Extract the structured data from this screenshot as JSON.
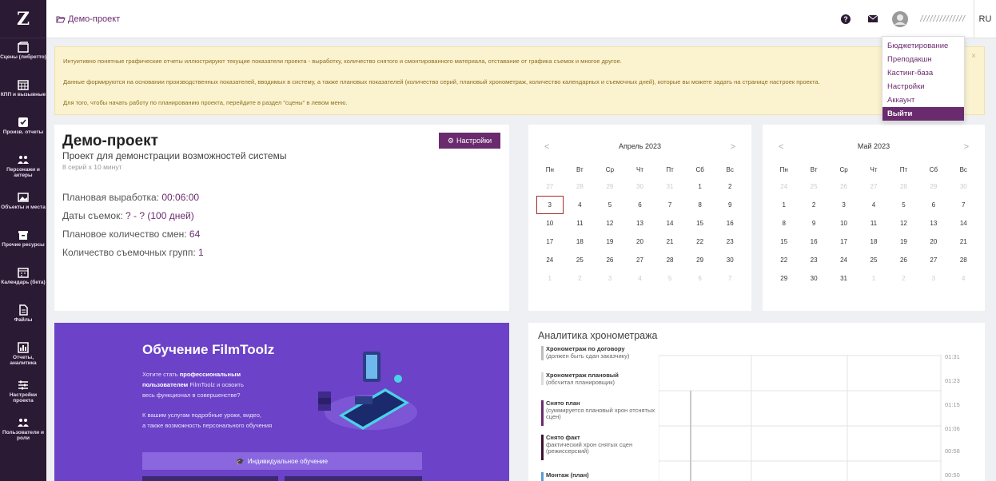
{
  "sidebar": {
    "logo": "Z",
    "items": [
      {
        "label": "Сцены (либретто)",
        "icon": "scenes-icon"
      },
      {
        "label": "КПП и вызывные",
        "icon": "calendar-grid-icon"
      },
      {
        "label": "Произв. отчеты",
        "icon": "checkbox-icon"
      },
      {
        "label": "Персонажи и актеры",
        "icon": "people-icon"
      },
      {
        "label": "Объекты и места",
        "icon": "image-icon"
      },
      {
        "label": "Прочие ресурсы",
        "icon": "box-icon"
      },
      {
        "label": "Календарь (бета)",
        "icon": "calendar-icon"
      },
      {
        "label": "Файлы",
        "icon": "file-icon"
      },
      {
        "label": "Отчеты, аналитика",
        "icon": "bar-chart-icon"
      },
      {
        "label": "Настройки проекта",
        "icon": "sliders-icon"
      },
      {
        "label": "Пользователи и роли",
        "icon": "users-icon"
      }
    ]
  },
  "topbar": {
    "breadcrumb": "Демо-проект",
    "user_name": "//////////////",
    "lang": "RU"
  },
  "user_menu": {
    "items": [
      "Бюджетирование",
      "Преподакшн",
      "Кастинг-база",
      "Настройки",
      "Аккаунт",
      "Выйти"
    ],
    "active_index": 5
  },
  "alert": {
    "line1": "Интуитивно понятные графические отчеты иллюстрируют текущие показатели проекта - выработку, количество снятого и смонтированного материала, отставание от графика съемок и многое другое.",
    "line2": "Данные формируются на основании производственных показателей, вводимых в систему, а также плановых показателей (количество серий, плановый хронометраж, количество календарных и съемочных дней), которые вы можете задать на странице настроек проекта.",
    "line3": "Для того, чтобы начать работу по планированию проекта, перейдите в раздел \"сцены\" в левом меню.",
    "close": "×"
  },
  "project": {
    "title": "Демо-проект",
    "subtitle": "Проект для демонстрации возможностей системы",
    "meta": "8 серий x 10 минут",
    "settings_label": "Настройки",
    "stats": [
      {
        "label": "Плановая выработка: ",
        "value": "00:06:00"
      },
      {
        "label": "Даты съемок: ",
        "value": "? - ? (100 дней)"
      },
      {
        "label": "Плановое количество смен: ",
        "value": "64"
      },
      {
        "label": "Количество съемочных групп: ",
        "value": "1"
      }
    ]
  },
  "calendars": [
    {
      "month": "Апрель 2023",
      "prev": "<",
      "next": ">",
      "weekdays": [
        "Пн",
        "Вт",
        "Ср",
        "Чт",
        "Пт",
        "Сб",
        "Вс"
      ],
      "days": [
        [
          "27",
          "28",
          "29",
          "30",
          "31",
          "1",
          "2"
        ],
        [
          "3",
          "4",
          "5",
          "6",
          "7",
          "8",
          "9"
        ],
        [
          "10",
          "11",
          "12",
          "13",
          "14",
          "15",
          "16"
        ],
        [
          "17",
          "18",
          "19",
          "20",
          "21",
          "22",
          "23"
        ],
        [
          "24",
          "25",
          "26",
          "27",
          "28",
          "29",
          "30"
        ],
        [
          "1",
          "2",
          "3",
          "4",
          "5",
          "6",
          "7"
        ]
      ]
    },
    {
      "month": "Май 2023",
      "prev": "<",
      "next": ">",
      "weekdays": [
        "Пн",
        "Вт",
        "Ср",
        "Чт",
        "Пт",
        "Сб",
        "Вс"
      ],
      "days": [
        [
          "24",
          "25",
          "26",
          "27",
          "28",
          "29",
          "30"
        ],
        [
          "1",
          "2",
          "3",
          "4",
          "5",
          "6",
          "7"
        ],
        [
          "8",
          "9",
          "10",
          "11",
          "12",
          "13",
          "14"
        ],
        [
          "15",
          "16",
          "17",
          "18",
          "19",
          "20",
          "21"
        ],
        [
          "22",
          "23",
          "24",
          "25",
          "26",
          "27",
          "28"
        ],
        [
          "29",
          "30",
          "31",
          "1",
          "2",
          "3",
          "4"
        ]
      ]
    }
  ],
  "promo": {
    "title": "Обучение FilmToolz",
    "text1": "Хотите стать ",
    "text1_bold": "профессиональным",
    "text2_bold": "пользователем",
    "text2": " FilmToolz и освоить",
    "text3": "весь функционал в совершенстве?",
    "text4": "К вашим услугам подробные уроки, видео,",
    "text5": "а также возможность персонального обучения",
    "button": "Индивидуальное обучение"
  },
  "analytics": {
    "title": "Аналитика хронометража",
    "legend": [
      {
        "title": "Хронометраж по договору",
        "sub": "(должен быть сдан заказчику)",
        "color": "#bdbdbd"
      },
      {
        "title": "Хронометраж плановый",
        "sub": "(обсчитал планировщик)",
        "color": "#dcdcdc"
      },
      {
        "title": "Снято план",
        "sub": "(суммируется плановый хрон отснятых сцен)",
        "color": "#6a2b6e"
      },
      {
        "title": "Снято факт",
        "sub": "фактический хрон снятых сцен (режиссерский)",
        "color": "#3a1330"
      },
      {
        "title": "Монтаж (план)",
        "sub": "",
        "color": "#5b9bd5"
      }
    ],
    "y_ticks": [
      "01:31",
      "01:23",
      "01:15",
      "01:06",
      "00:58",
      "00:50"
    ]
  }
}
